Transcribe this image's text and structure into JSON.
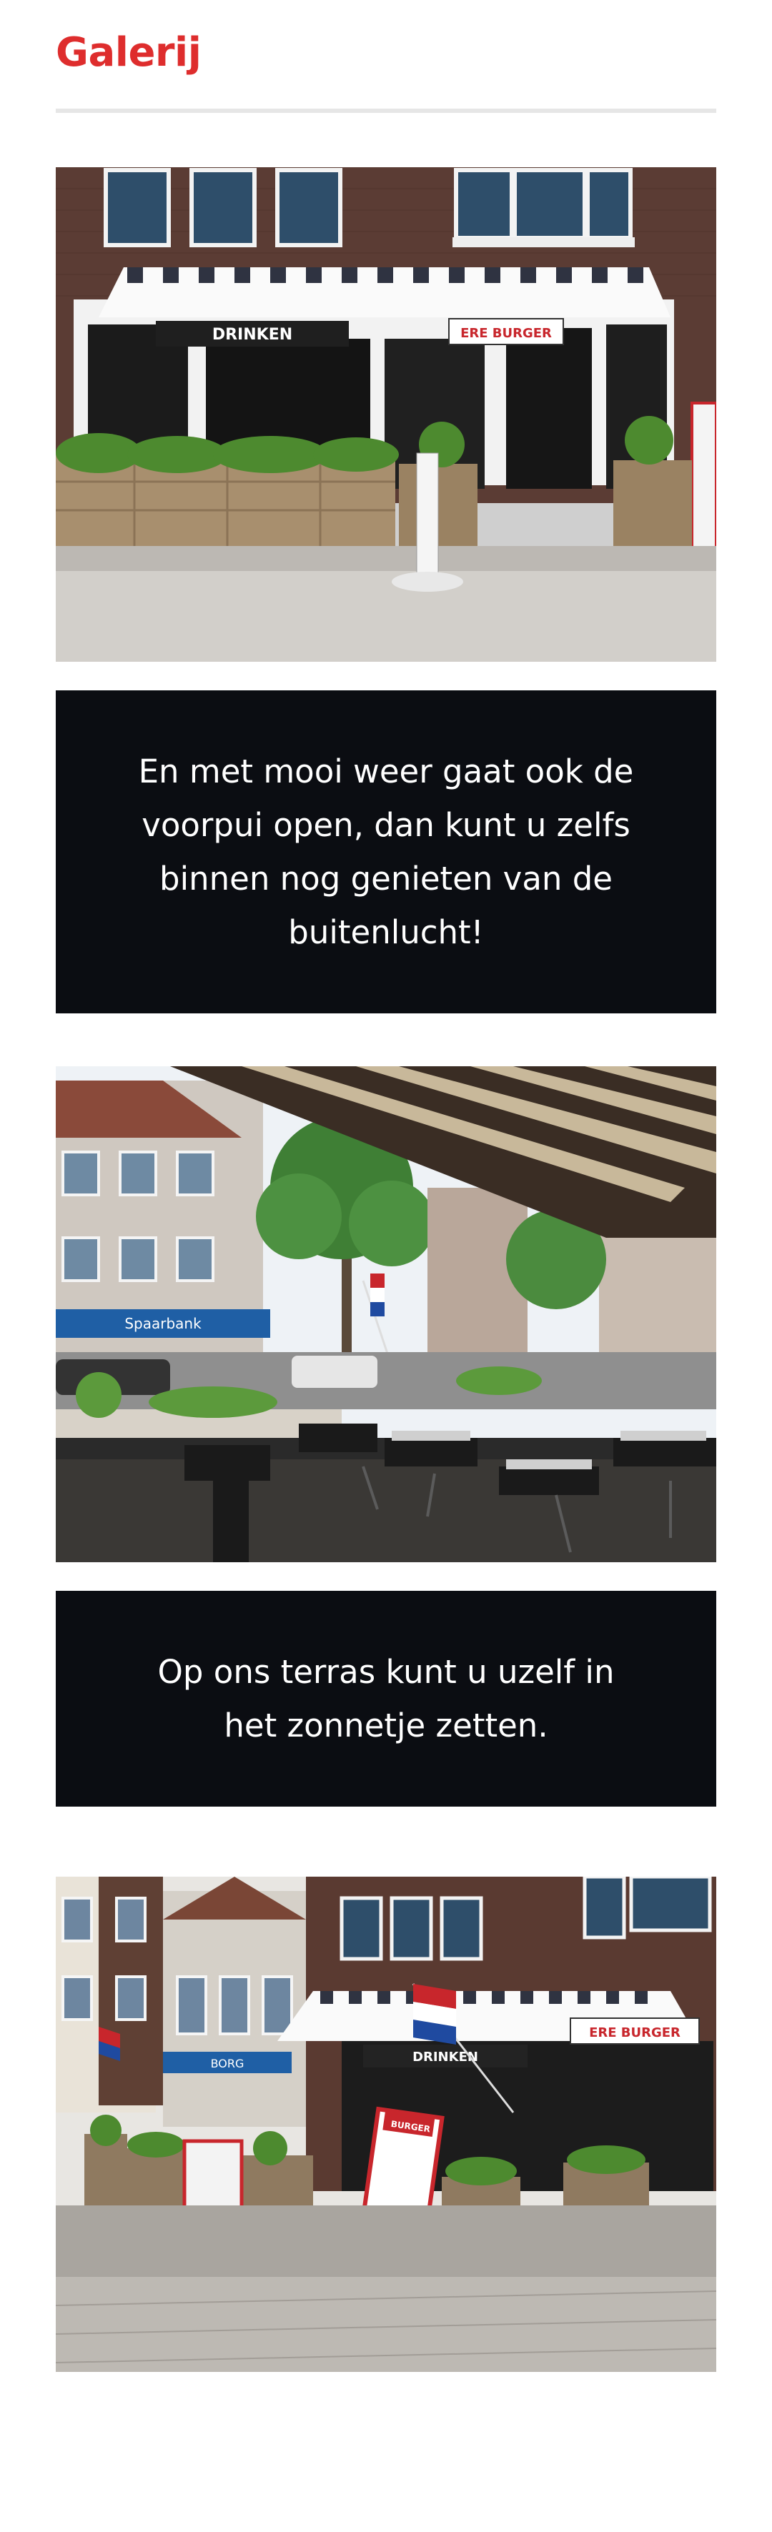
{
  "gallery": {
    "title": "Galerij",
    "colors": {
      "title": "#de2d2d",
      "caption_background": "#0b0d12",
      "caption_text": "#ffffff",
      "divider": "#e6e6e6"
    },
    "items": [
      {
        "type": "photo",
        "signs": [
          "DRINKEN",
          "ERE BURGER"
        ]
      },
      {
        "type": "caption",
        "text": "En met mooi weer gaat ook de voorpui open, dan kunt u zelfs binnen nog genieten van de buitenlucht!"
      },
      {
        "type": "photo",
        "signs": [
          "Spaarbank"
        ]
      },
      {
        "type": "caption",
        "text": "Op ons terras kunt u uzelf in het zonnetje zetten."
      },
      {
        "type": "photo",
        "signs": [
          "DRINKEN",
          "ERE BURGER",
          "BURGER",
          "BORG"
        ]
      }
    ]
  }
}
